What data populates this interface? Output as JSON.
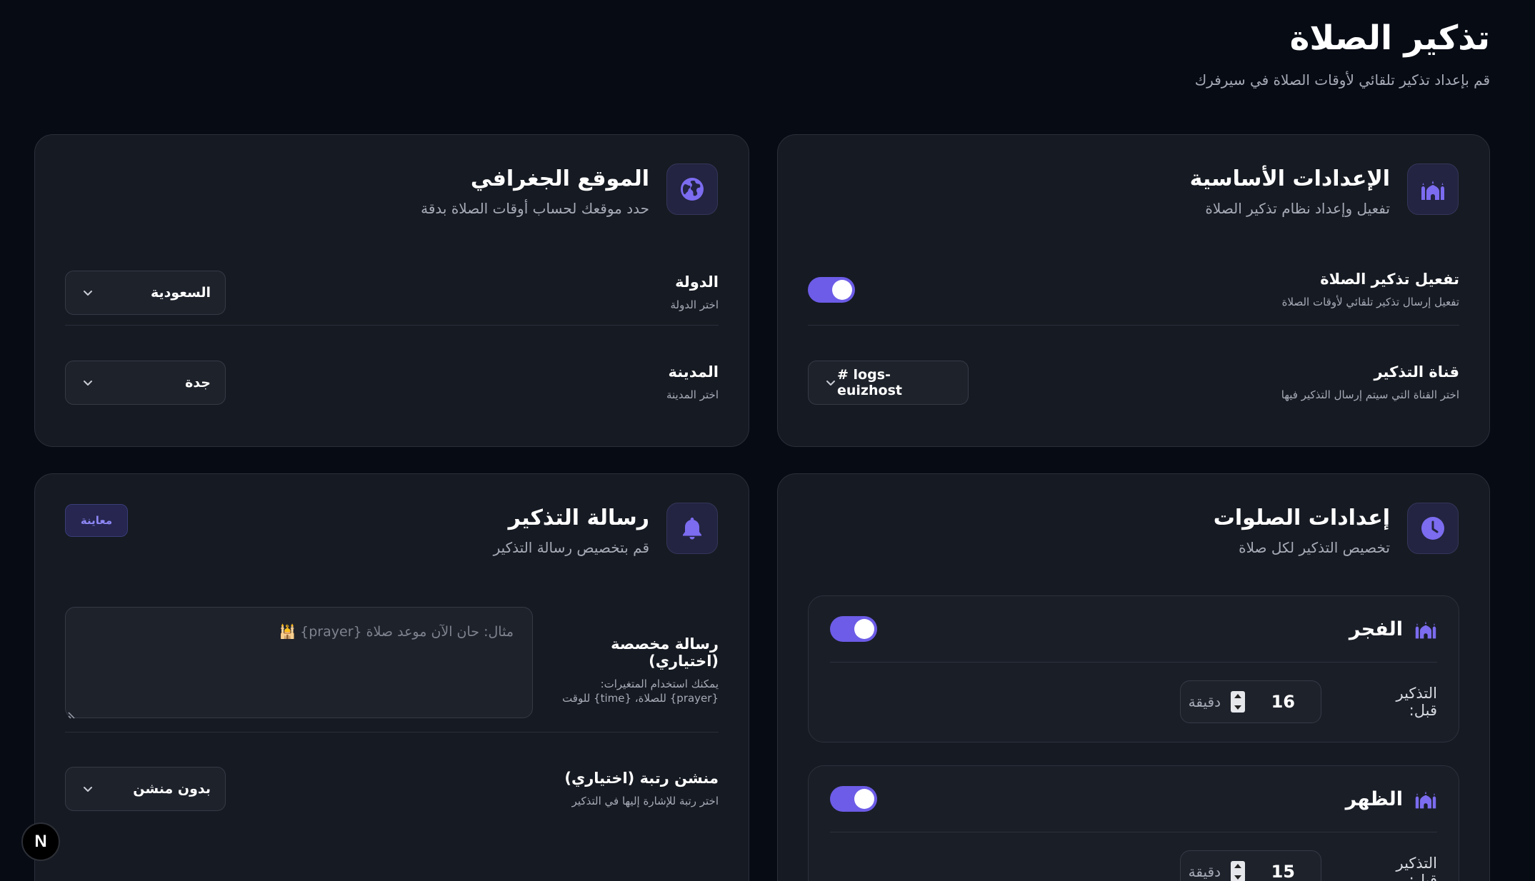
{
  "header": {
    "title": "تذكير الصلاة",
    "subtitle": "قم بإعداد تذكير تلقائي لأوقات الصلاة في سيرفرك"
  },
  "colors": {
    "background": "#070b14",
    "card": "#161a22",
    "accent": "#6c5ce7",
    "icon_color": "#7b6cf0",
    "muted_text": "#a6abb7"
  },
  "basic_settings": {
    "icon": "mosque-icon",
    "title": "الإعدادات الأساسية",
    "description": "تفعيل وإعداد نظام تذكير الصلاة",
    "enable": {
      "label": "تفعيل تذكير الصلاة",
      "help": "تفعيل إرسال تذكير تلقائي لأوقات الصلاة",
      "enabled": true
    },
    "channel": {
      "label": "قناة التذكير",
      "help": "اختر القناة التي سيتم إرسال التذكير فيها",
      "value": "# logs-euizhost"
    }
  },
  "location": {
    "icon": "globe-icon",
    "title": "الموقع الجغرافي",
    "description": "حدد موقعك لحساب أوقات الصلاة بدقة",
    "country": {
      "label": "الدولة",
      "help": "اختر الدولة",
      "value": "السعودية"
    },
    "city": {
      "label": "المدينة",
      "help": "اختر المدينة",
      "value": "جدة"
    }
  },
  "prayers_settings": {
    "icon": "clock-icon",
    "title": "إعدادات الصلوات",
    "description": "تخصيص التذكير لكل صلاة",
    "prayers": [
      {
        "name": "الفجر",
        "enabled": true,
        "before_label": "التذكير قبل:",
        "minutes": "16",
        "unit": "دقيقة"
      },
      {
        "name": "الظهر",
        "enabled": true,
        "before_label": "التذكير قبل:",
        "minutes": "15",
        "unit": "دقيقة"
      }
    ]
  },
  "message": {
    "icon": "bell-icon",
    "title": "رسالة التذكير",
    "description": "قم بتخصيص رسالة التذكير",
    "preview_label": "معاينة",
    "custom": {
      "label": "رسالة مخصصة (اختياري)",
      "help": "يمكنك استخدام المتغيرات: {prayer} للصلاة، {time} للوقت",
      "placeholder": "مثال: حان الآن موعد صلاة {prayer} 🕌"
    },
    "mention": {
      "label": "منشن رتبة (اختياري)",
      "help": "اختر رتبة للإشارة إليها في التذكير",
      "value": "بدون منشن"
    }
  },
  "next_badge": "N"
}
